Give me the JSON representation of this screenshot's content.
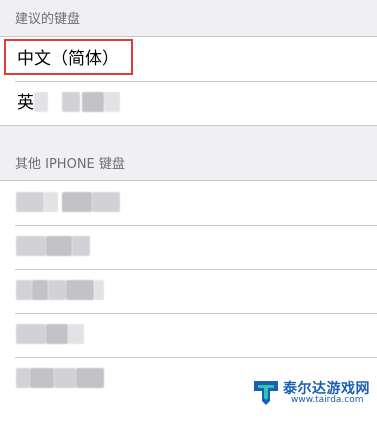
{
  "suggested_section": {
    "header": "建议的键盘",
    "items": [
      {
        "label": "中文（简体）",
        "highlighted": true
      },
      {
        "label": "英"
      }
    ]
  },
  "other_section": {
    "header": "其他 IPHONE 键盘",
    "row_count": 5
  },
  "watermark": {
    "title": "泰尔达游戏网",
    "url": "www.tairda.com"
  },
  "colors": {
    "background": "#efeff4",
    "highlight": "#e03a3a",
    "section_header": "#6d6d72",
    "watermark": "#1a5fb4"
  }
}
